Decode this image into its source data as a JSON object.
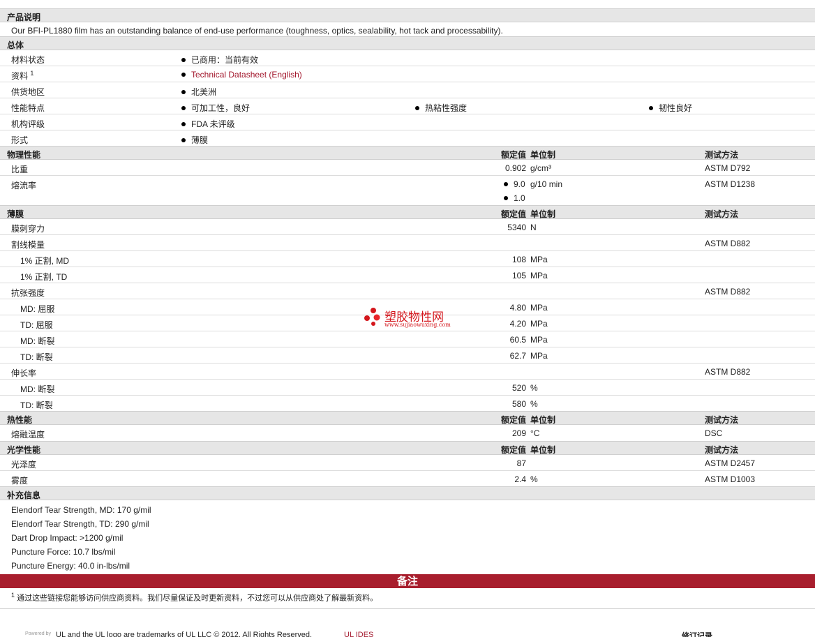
{
  "description": {
    "title": "产品说明",
    "text": "Our BFI-PL1880 film has an outstanding balance of end-use performance (toughness, optics, sealability, hot tack and processability)."
  },
  "general": {
    "title": "总体",
    "rows": [
      {
        "label": "材料状态",
        "items": [
          "已商用：当前有效"
        ]
      },
      {
        "label": "资料",
        "sup": "1",
        "items": [
          "Technical Datasheet (English)"
        ]
      },
      {
        "label": "供货地区",
        "items": [
          "北美洲"
        ]
      },
      {
        "label": "性能特点",
        "items": [
          "可加工性，良好",
          "热粘性强度",
          "韧性良好"
        ]
      },
      {
        "label": "机构评级",
        "items": [
          "FDA 未评级"
        ]
      },
      {
        "label": "形式",
        "items": [
          "薄膜"
        ]
      }
    ]
  },
  "headers": {
    "nominal": "额定值",
    "unit": "单位制",
    "method": "测试方法"
  },
  "physical": {
    "title": "物理性能",
    "specific_gravity": {
      "label": "比重",
      "value": "0.902",
      "unit": "g/cm³",
      "method": "ASTM D792"
    },
    "melt_flow": {
      "label": "熔流率",
      "value1": "9.0",
      "unit1": "g/10 min",
      "value2": "1.0",
      "method": "ASTM D1238"
    }
  },
  "film": {
    "title": "薄膜",
    "puncture": {
      "label": "膜刺穿力",
      "value": "5340",
      "unit": "N"
    },
    "secant": {
      "label": "割线模量",
      "method": "ASTM D882",
      "rows": [
        {
          "label": "1% 正割, MD",
          "value": "108",
          "unit": "MPa"
        },
        {
          "label": "1% 正割, TD",
          "value": "105",
          "unit": "MPa"
        }
      ]
    },
    "tensile": {
      "label": "抗张强度",
      "method": "ASTM D882",
      "rows": [
        {
          "label": "MD: 屈服",
          "value": "4.80",
          "unit": "MPa"
        },
        {
          "label": "TD: 屈服",
          "value": "4.20",
          "unit": "MPa"
        },
        {
          "label": "MD: 断裂",
          "value": "60.5",
          "unit": "MPa"
        },
        {
          "label": "TD: 断裂",
          "value": "62.7",
          "unit": "MPa"
        }
      ]
    },
    "elongation": {
      "label": "伸长率",
      "method": "ASTM D882",
      "rows": [
        {
          "label": "MD: 断裂",
          "value": "520",
          "unit": "%"
        },
        {
          "label": "TD: 断裂",
          "value": "580",
          "unit": "%"
        }
      ]
    }
  },
  "thermal": {
    "title": "热性能",
    "melt_temp": {
      "label": "熔融温度",
      "value": "209",
      "unit": "°C",
      "method": "DSC"
    }
  },
  "optical": {
    "title": "光学性能",
    "gloss": {
      "label": "光泽度",
      "value": "87",
      "unit": "",
      "method": "ASTM D2457"
    },
    "haze": {
      "label": "雾度",
      "value": "2.4",
      "unit": "%",
      "method": "ASTM D1003"
    }
  },
  "supplemental": {
    "title": "补充信息",
    "lines": [
      "Elendorf Tear Strength, MD: 170 g/mil",
      "Elendorf Tear Strength, TD: 290 g/mil",
      "Dart Drop Impact: >1200 g/mil",
      "Puncture Force: 10.7 lbs/mil",
      "Puncture Energy: 40.0 in-lbs/mil"
    ]
  },
  "notes": {
    "title": "备注",
    "sup": "1",
    "text": "通过这些链接您能够访问供应商资料。我们尽量保证及时更新资料，不过您可以从供应商处了解最新资料。"
  },
  "footer": {
    "powered": "Powered by",
    "trademark": "UL and the UL logo are trademarks of UL LLC © 2012. All Rights Reserved.",
    "ides": "UL IDES",
    "revision": "修订记录"
  },
  "watermark": {
    "name": "塑胶物性网",
    "url": "www.sujiaowuxing.com"
  },
  "colors": {
    "accent": "#a81e2d",
    "link": "#a3182d",
    "section_bg": "#e6e6e6"
  }
}
